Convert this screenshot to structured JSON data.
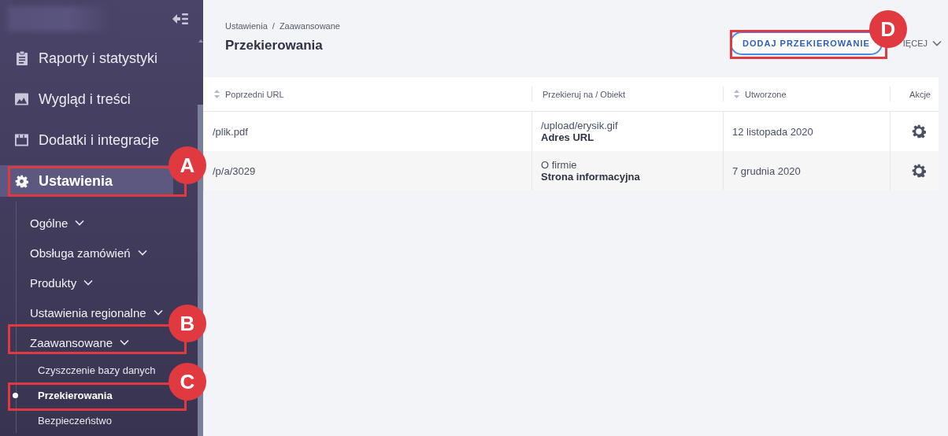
{
  "sidebar": {
    "items": [
      {
        "label": "Raporty i statystyki",
        "selected": false
      },
      {
        "label": "Wygląd i treści",
        "selected": false
      },
      {
        "label": "Dodatki i integracje",
        "selected": false
      },
      {
        "label": "Ustawienia",
        "selected": true,
        "children": [
          {
            "label": "Ogólne"
          },
          {
            "label": "Obsługa zamówień"
          },
          {
            "label": "Produkty"
          },
          {
            "label": "Ustawienia regionalne"
          },
          {
            "label": "Zaawansowane",
            "children": [
              {
                "label": "Czyszczenie bazy danych",
                "selected": false
              },
              {
                "label": "Przekierowania",
                "selected": true
              },
              {
                "label": "Bezpieczeństwo",
                "selected": false
              }
            ]
          }
        ]
      }
    ]
  },
  "breadcrumb": [
    "Ustawienia",
    "/",
    "Zaawansowane"
  ],
  "page_title": "Przekierowania",
  "actions": {
    "primary": "DODAJ PRZEKIEROWANIE",
    "more": "IĘCEJ"
  },
  "table": {
    "columns": [
      {
        "label": "Poprzedni URL",
        "sortable": true
      },
      {
        "label": "Przekieruj na / Obiekt",
        "sortable": false
      },
      {
        "label": "Utworzone",
        "sortable": true
      },
      {
        "label": "Akcje",
        "sortable": false
      }
    ],
    "rows": [
      {
        "old_url": "/plik.pdf",
        "target": "/upload/erysik.gif",
        "target_type": "Adres URL",
        "created": "12 listopada 2020"
      },
      {
        "old_url": "/p/a/3029",
        "target": "O firmie",
        "target_type": "Strona informacyjna",
        "created": "7 grudnia 2020"
      }
    ]
  },
  "annotations": [
    {
      "label": "A"
    },
    {
      "label": "B"
    },
    {
      "label": "C"
    },
    {
      "label": "D"
    }
  ]
}
